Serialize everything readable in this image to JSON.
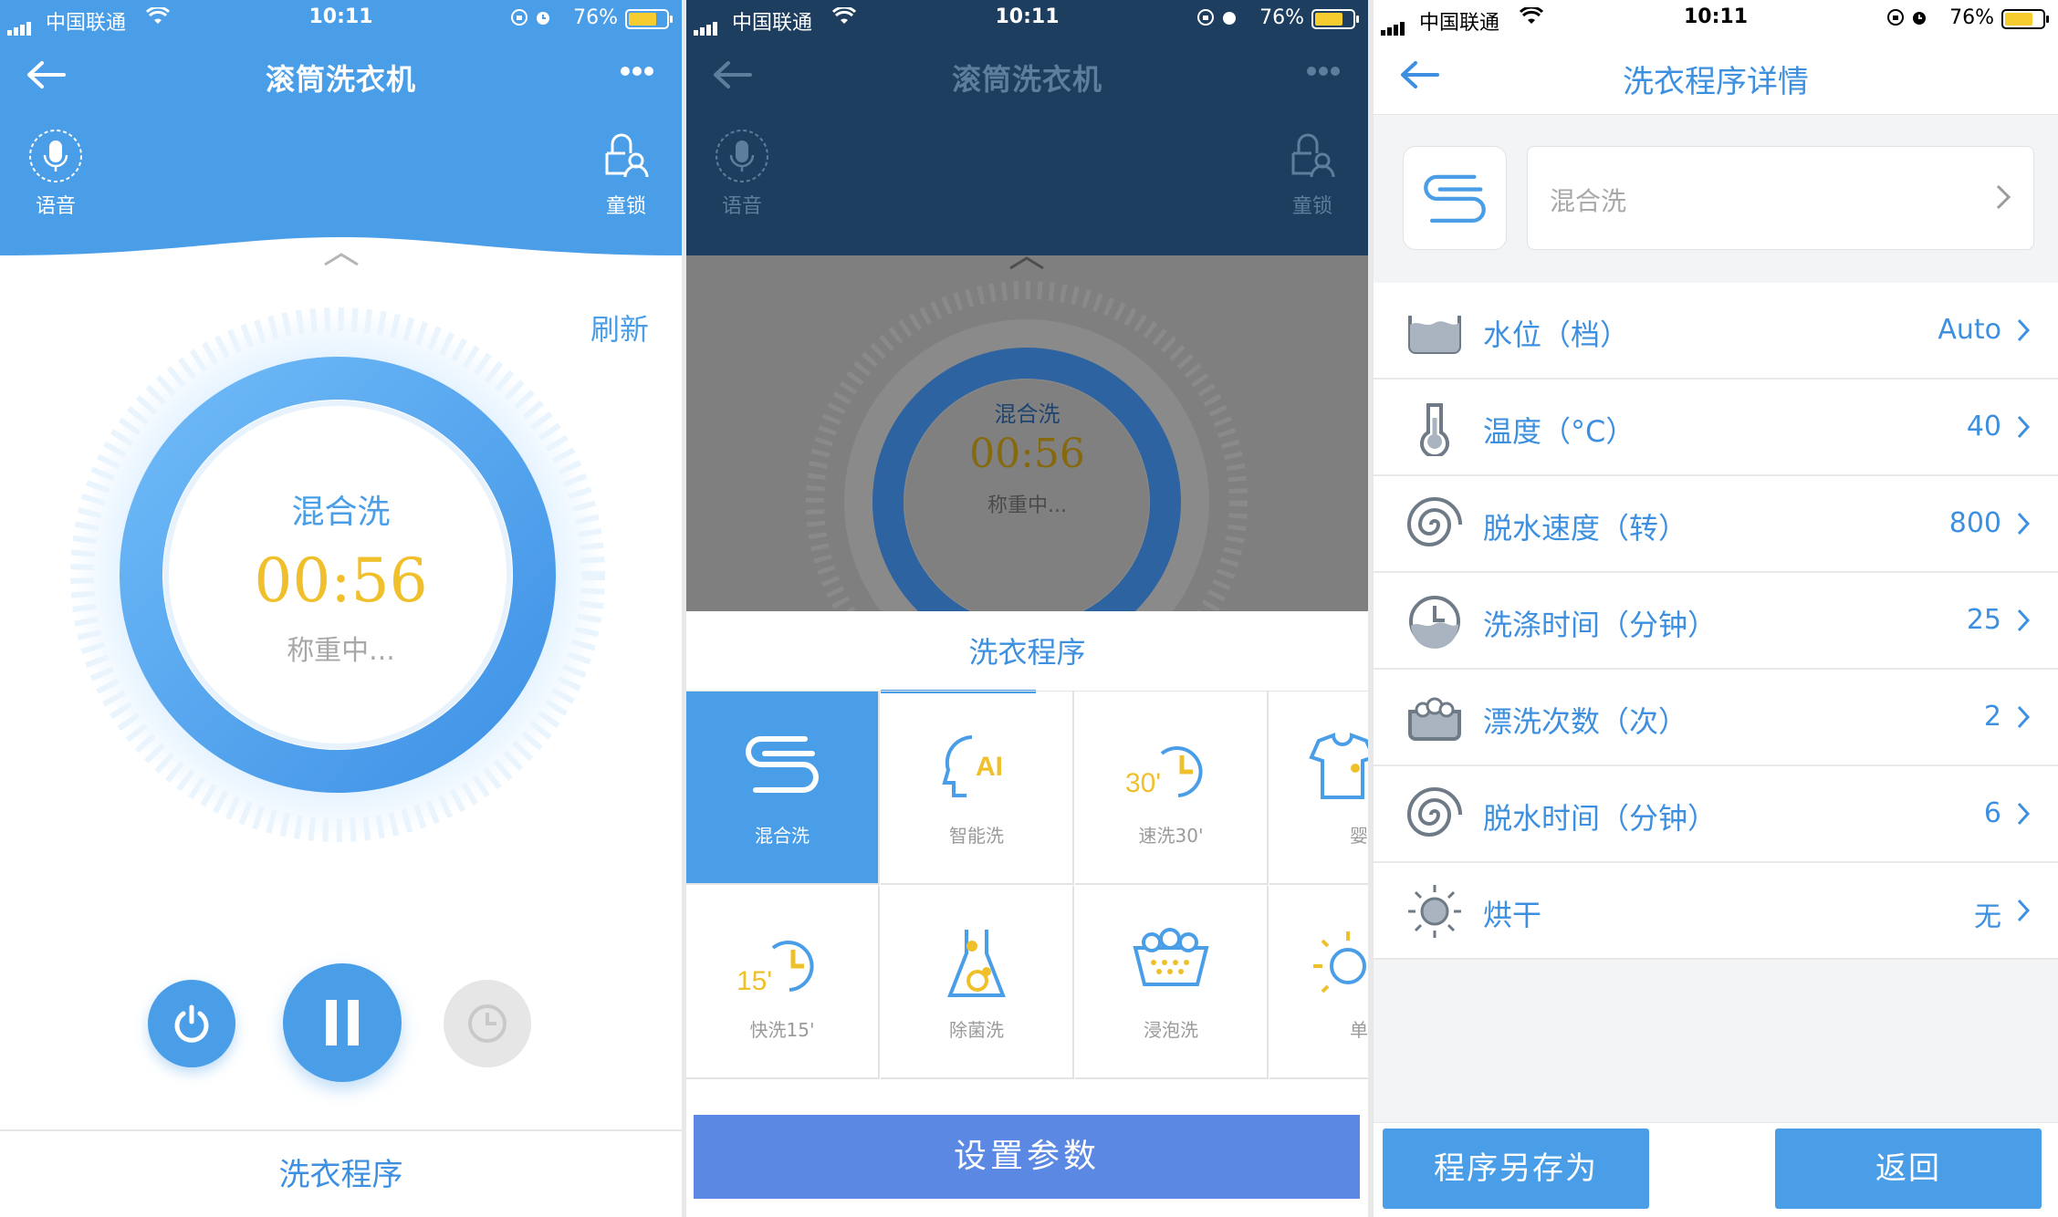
{
  "status_bar": {
    "carrier": "中国联通",
    "time": "10:11",
    "battery": "76%"
  },
  "panel1": {
    "title": "滚筒洗衣机",
    "voice_label": "语音",
    "child_lock_label": "童锁",
    "refresh_label": "刷新",
    "program_name": "混合洗",
    "remaining_time": "00:56",
    "status_text": "称重中...",
    "footer_label": "洗衣程序"
  },
  "panel2": {
    "title": "滚筒洗衣机",
    "voice_label": "语音",
    "child_lock_label": "童锁",
    "program_name": "混合洗",
    "remaining_time": "00:56",
    "status_text": "称重中...",
    "sheet_title": "洗衣程序",
    "programs": [
      {
        "label": "混合洗",
        "icon": "mixed-wash-icon",
        "selected": true
      },
      {
        "label": "智能洗",
        "icon": "ai-wash-icon",
        "selected": false
      },
      {
        "label": "速洗30'",
        "icon": "quick-30-icon",
        "selected": false,
        "badge": "30'"
      },
      {
        "label": "婴儿",
        "icon": "baby-clothes-icon",
        "selected": false
      },
      {
        "label": "快洗15'",
        "icon": "quick-15-icon",
        "selected": false,
        "badge": "15'"
      },
      {
        "label": "除菌洗",
        "icon": "sterilize-icon",
        "selected": false
      },
      {
        "label": "浸泡洗",
        "icon": "soak-icon",
        "selected": false
      },
      {
        "label": "单烘",
        "icon": "dry-only-icon",
        "selected": false
      }
    ],
    "set_params_label": "设置参数"
  },
  "panel3": {
    "title": "洗衣程序详情",
    "program_value": "混合洗",
    "rows": [
      {
        "label": "水位（档）",
        "value": "Auto",
        "icon": "water-level-icon"
      },
      {
        "label": "温度（°C）",
        "value": "40",
        "icon": "thermometer-icon"
      },
      {
        "label": "脱水速度（转）",
        "value": "800",
        "icon": "spin-speed-icon"
      },
      {
        "label": "洗涤时间（分钟）",
        "value": "25",
        "icon": "wash-time-icon"
      },
      {
        "label": "漂洗次数（次）",
        "value": "2",
        "icon": "rinse-icon"
      },
      {
        "label": "脱水时间（分钟）",
        "value": "6",
        "icon": "spin-time-icon"
      },
      {
        "label": "烘干",
        "value": "无",
        "icon": "dryer-sun-icon"
      }
    ],
    "save_as_label": "程序另存为",
    "back_label": "返回"
  },
  "colors": {
    "primary": "#4a9ee8",
    "accent_time": "#f0c02c",
    "button_blue": "#5a88e3",
    "overlay_dark": "#1d3e5e"
  }
}
